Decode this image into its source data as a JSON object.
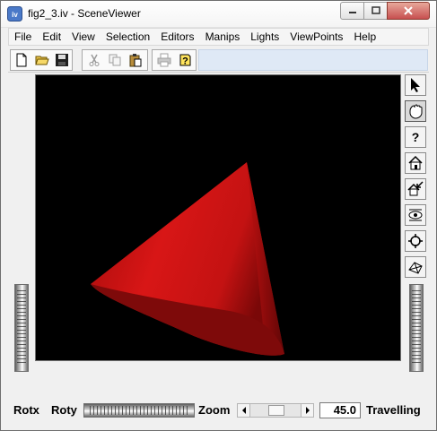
{
  "window": {
    "title": "fig2_3.iv - SceneViewer",
    "app_icon": "iv-icon",
    "controls": [
      "minimize-icon",
      "maximize-icon",
      "close-icon"
    ]
  },
  "menubar": {
    "items": [
      "File",
      "Edit",
      "View",
      "Selection",
      "Editors",
      "Manips",
      "Lights",
      "ViewPoints",
      "Help"
    ]
  },
  "toolbar": {
    "buttons": [
      {
        "icon": "new-file-icon",
        "enabled": true
      },
      {
        "icon": "open-folder-icon",
        "enabled": true
      },
      {
        "icon": "save-icon",
        "enabled": true
      },
      {
        "icon": "cut-icon",
        "enabled": false
      },
      {
        "icon": "copy-icon",
        "enabled": false
      },
      {
        "icon": "paste-icon",
        "enabled": true
      },
      {
        "icon": "print-icon",
        "enabled": false
      },
      {
        "icon": "help-icon",
        "enabled": true
      }
    ]
  },
  "viewer": {
    "background_color": "#000000",
    "object_color": "#cc1111",
    "side_buttons": [
      {
        "icon": "pick-arrow-icon",
        "active": false
      },
      {
        "icon": "view-hand-icon",
        "active": true
      },
      {
        "icon": "question-icon",
        "active": false
      },
      {
        "icon": "home-icon",
        "active": false
      },
      {
        "icon": "set-home-icon",
        "active": false
      },
      {
        "icon": "view-all-icon",
        "active": false
      },
      {
        "icon": "seek-icon",
        "active": false
      },
      {
        "icon": "projection-icon",
        "active": false
      }
    ]
  },
  "statusbar": {
    "rotx_label": "Rotx",
    "roty_label": "Roty",
    "zoom_label": "Zoom",
    "zoom_value": "45.0",
    "mode_label": "Travelling"
  }
}
